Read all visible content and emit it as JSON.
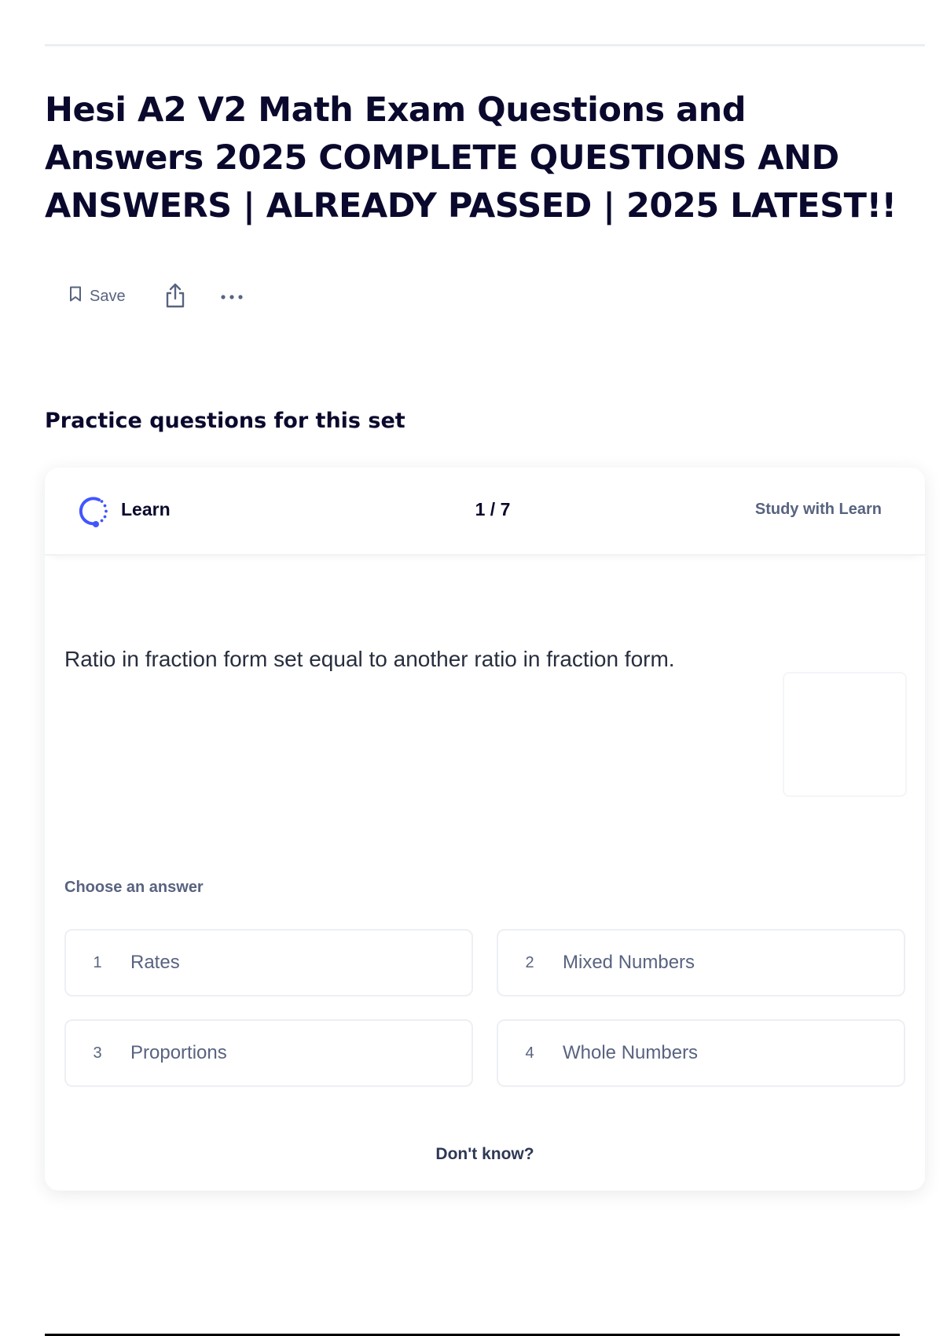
{
  "page": {
    "title": "Hesi A2 V2 Math Exam Questions and Answers 2025 COMPLETE QUESTIONS AND ANSWERS | ALREADY PASSED | 2025 LATEST!!"
  },
  "actions": {
    "save_label": "Save",
    "save_icon": "bookmark-icon",
    "share_icon": "share-icon",
    "more_icon": "more-icon"
  },
  "practice": {
    "heading": "Practice questions for this set",
    "mode_label": "Learn",
    "mode_icon": "learn-icon",
    "progress": "1 / 7",
    "study_link": "Study with Learn",
    "question": "Ratio in fraction form set equal to another ratio in fraction form.",
    "choose_label": "Choose an answer",
    "answers": [
      {
        "number": "1",
        "text": "Rates"
      },
      {
        "number": "2",
        "text": "Mixed Numbers"
      },
      {
        "number": "3",
        "text": "Proportions"
      },
      {
        "number": "4",
        "text": "Whole Numbers"
      }
    ],
    "dont_know": "Don't know?"
  },
  "colors": {
    "accent": "#4255ff",
    "text_primary": "#0a092d",
    "text_secondary": "#586380"
  }
}
